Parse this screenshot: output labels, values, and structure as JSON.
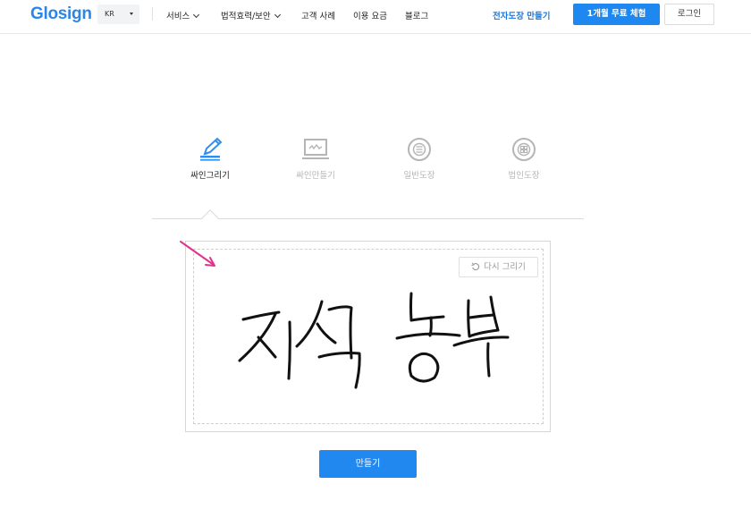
{
  "header": {
    "logo": "Glosign",
    "lang": "KR",
    "nav": [
      {
        "label": "서비스",
        "has_dropdown": true
      },
      {
        "label": "법적효력/보안",
        "has_dropdown": true
      },
      {
        "label": "고객 사례",
        "has_dropdown": false
      },
      {
        "label": "이용 요금",
        "has_dropdown": false
      },
      {
        "label": "블로그",
        "has_dropdown": false
      }
    ],
    "stamp_link": "전자도장 만들기",
    "trial_button": "1개월 무료 체험",
    "login_button": "로그인"
  },
  "tabs": [
    {
      "label": "싸인그리기",
      "icon": "pen-draw-icon",
      "active": true
    },
    {
      "label": "싸인만들기",
      "icon": "monitor-signature-icon",
      "active": false
    },
    {
      "label": "일반도장",
      "icon": "round-stamp-icon",
      "active": false
    },
    {
      "label": "법인도장",
      "icon": "seal-stamp-icon",
      "active": false
    }
  ],
  "canvas": {
    "redraw_label": "다시 그리기",
    "signature_content": "handwritten-signature",
    "annotation": "pink-arrow"
  },
  "make_button": "만들기",
  "colors": {
    "brand": "#2b86e8",
    "primary_button": "#1e88f0",
    "active_icon": "#2f8ff0",
    "inactive": "#b5b5b5",
    "arrow": "#e0338b"
  }
}
